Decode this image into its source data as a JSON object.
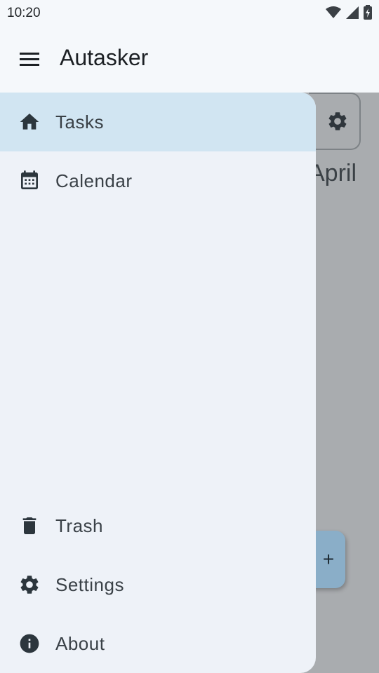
{
  "status_bar": {
    "time": "10:20"
  },
  "app_bar": {
    "title": "Autasker"
  },
  "background": {
    "month": "April",
    "fab_label": "+"
  },
  "drawer": {
    "items": [
      {
        "label": "Tasks",
        "icon": "home-icon",
        "active": true
      },
      {
        "label": "Calendar",
        "icon": "calendar-icon"
      },
      {
        "label": "Trash",
        "icon": "trash-icon"
      },
      {
        "label": "Settings",
        "icon": "gear-icon"
      },
      {
        "label": "About",
        "icon": "info-icon"
      }
    ]
  },
  "colors": {
    "active_item_bg": "#d1e5f2",
    "drawer_bg": "#eef2f8",
    "scrim": "#a9acaf",
    "icon": "#2c363d"
  }
}
